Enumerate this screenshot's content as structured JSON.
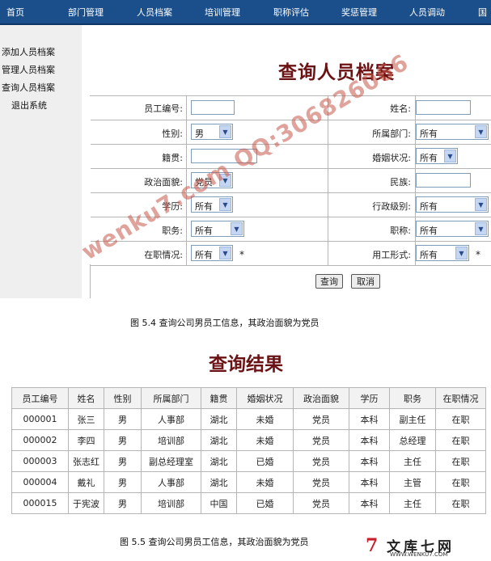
{
  "nav": [
    "首页",
    "部门管理",
    "人员档案",
    "培训管理",
    "职称评估",
    "奖惩管理",
    "人员调动",
    "国"
  ],
  "sidebar": [
    "添加人员档案",
    "管理人员档案",
    "查询人员档案",
    "退出系统"
  ],
  "form": {
    "title": "查询人员档案",
    "emp_id": {
      "label": "员工编号:",
      "value": ""
    },
    "name": {
      "label": "姓名:",
      "value": ""
    },
    "gender": {
      "label": "性别:",
      "value": "男"
    },
    "dept": {
      "label": "所属部门:",
      "value": "所有"
    },
    "native": {
      "label": "籍贯:",
      "value": ""
    },
    "marital": {
      "label": "婚姻状况:",
      "value": "所有"
    },
    "political": {
      "label": "政治面貌:",
      "value": "党员"
    },
    "ethnic": {
      "label": "民族:",
      "value": ""
    },
    "education": {
      "label": "学历:",
      "value": "所有"
    },
    "admin_level": {
      "label": "行政级别:",
      "value": "所有"
    },
    "position": {
      "label": "职务:",
      "value": "所有"
    },
    "title_rank": {
      "label": "职称:",
      "value": "所有"
    },
    "status": {
      "label": "在职情况:",
      "value": "所有"
    },
    "employ_type": {
      "label": "用工形式:",
      "value": "所有"
    },
    "star": "*",
    "query_button": "查询",
    "cancel_button": "取消"
  },
  "caption1": "图 5.4 查询公司男员工信息，其政治面貌为党员",
  "results": {
    "title": "查询结果",
    "headers": [
      "员工编号",
      "姓名",
      "性别",
      "所属部门",
      "籍贯",
      "婚姻状况",
      "政治面貌",
      "学历",
      "职务",
      "在职情况"
    ],
    "rows": [
      [
        "000001",
        "张三",
        "男",
        "人事部",
        "湖北",
        "未婚",
        "党员",
        "本科",
        "副主任",
        "在职"
      ],
      [
        "000002",
        "李四",
        "男",
        "培训部",
        "湖北",
        "未婚",
        "党员",
        "本科",
        "总经理",
        "在职"
      ],
      [
        "000003",
        "张志红",
        "男",
        "副总经理室",
        "湖北",
        "已婚",
        "党员",
        "本科",
        "主任",
        "在职"
      ],
      [
        "000004",
        "戴礼",
        "男",
        "人事部",
        "湖北",
        "未婚",
        "党员",
        "本科",
        "主管",
        "在职"
      ],
      [
        "000015",
        "于宪波",
        "男",
        "培训部",
        "中国",
        "已婚",
        "党员",
        "本科",
        "主任",
        "在职"
      ]
    ]
  },
  "caption2": "图 5.5 查询公司男员工信息，其政治面貌为党员",
  "watermark": "wenku7.com  QQ:306826066",
  "logo": {
    "mark": "7",
    "text": "文库七网",
    "url": "WWW.WENKU7.COM"
  },
  "colors": {
    "nav_bg": "#1a4f8c",
    "title": "#6b1214",
    "watermark": "#c8584a"
  }
}
